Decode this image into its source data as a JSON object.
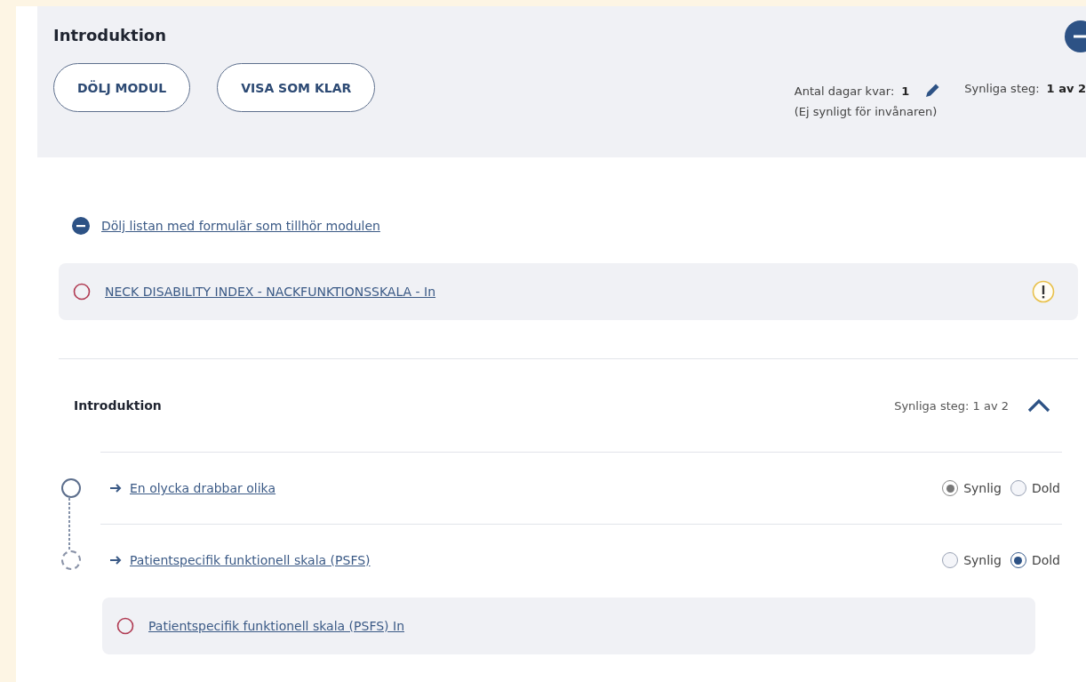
{
  "module": {
    "title": "Introduktion",
    "expanded": true,
    "buttons": [
      "DÖLJ MODUL",
      "VISA SOM KLAR"
    ],
    "days_label": "Antal dagar kvar:",
    "days_value": "1",
    "days_note": "(Ej synligt för invånaren)",
    "steps_label": "Synliga steg:",
    "steps_value": "1 av 2"
  },
  "forms_toggle": {
    "label": "Dölj listan med formulär som tillhör modulen",
    "expanded": true
  },
  "forms": [
    {
      "title": "NECK DISABILITY INDEX - NACKFUNKTIONSSKALA - In",
      "warning": true
    }
  ],
  "section": {
    "title": "Introduktion",
    "summary": "Synliga steg: 1 av 2",
    "expanded": true,
    "steps": [
      {
        "title": "En olycka drabbar olika",
        "disabled": true,
        "options": [
          {
            "label": "Synlig",
            "selected": true
          },
          {
            "label": "Dold",
            "selected": false
          }
        ]
      },
      {
        "title": "Patientspecifik funktionell skala (PSFS)",
        "disabled": false,
        "options": [
          {
            "label": "Synlig",
            "selected": false
          },
          {
            "label": "Dold",
            "selected": true
          }
        ],
        "forms": [
          {
            "title": "Patientspecifik funktionell skala (PSFS) In",
            "warning": false
          }
        ]
      }
    ]
  }
}
